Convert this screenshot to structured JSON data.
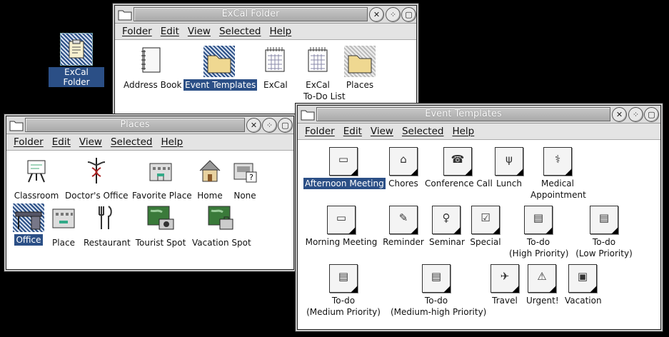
{
  "desktop": {
    "icon_label": "ExCal Folder"
  },
  "excal_window": {
    "title": "ExCal Folder",
    "menu": [
      "Folder",
      "Edit",
      "View",
      "Selected",
      "Help"
    ],
    "items": [
      {
        "label": "Address Book",
        "icon": "address-book-icon"
      },
      {
        "label": "Event Templates",
        "icon": "folder-icon",
        "selected": true
      },
      {
        "label": "ExCal",
        "icon": "calendar-icon"
      },
      {
        "label": "ExCal",
        "label2": "To-Do List",
        "icon": "todo-calendar-icon"
      },
      {
        "label": "Places",
        "icon": "folder-icon"
      }
    ]
  },
  "places_window": {
    "title": "Places",
    "menu": [
      "Folder",
      "Edit",
      "View",
      "Selected",
      "Help"
    ],
    "items": [
      {
        "label": "Classroom",
        "icon": "easel-icon"
      },
      {
        "label": "Doctor's Office",
        "icon": "caduceus-icon"
      },
      {
        "label": "Favorite Place",
        "icon": "building-icon"
      },
      {
        "label": "Home",
        "icon": "house-icon"
      },
      {
        "label": "None",
        "icon": "unknown-place-icon"
      },
      {
        "label": "Office",
        "icon": "desk-icon",
        "selected": true
      },
      {
        "label": "Place",
        "icon": "building-icon"
      },
      {
        "label": "Restaurant",
        "icon": "utensils-icon"
      },
      {
        "label": "Tourist Spot",
        "icon": "map-camera-icon"
      },
      {
        "label": "Vacation Spot",
        "icon": "map-suitcase-icon"
      }
    ]
  },
  "event_window": {
    "title": "Event Templates",
    "menu": [
      "Folder",
      "Edit",
      "View",
      "Selected",
      "Help"
    ],
    "items": [
      {
        "label": "Afternoon Meeting",
        "icon": "meeting-icon",
        "selected": true
      },
      {
        "label": "Chores",
        "icon": "house-icon"
      },
      {
        "label": "Conference Call",
        "icon": "telephone-icon"
      },
      {
        "label": "Lunch",
        "icon": "utensils-icon"
      },
      {
        "label": "Medical",
        "label2": "Appointment",
        "icon": "caduceus-icon"
      },
      {
        "label": "Morning Meeting",
        "icon": "meeting-icon"
      },
      {
        "label": "Reminder",
        "icon": "note-icon"
      },
      {
        "label": "Seminar",
        "icon": "podium-icon"
      },
      {
        "label": "Special",
        "icon": "checkbox-icon"
      },
      {
        "label": "To-do",
        "label2": "(High Priority)",
        "icon": "todo-icon"
      },
      {
        "label": "To-do",
        "label2": "(Low Priority)",
        "icon": "todo-icon"
      },
      {
        "label": "To-do",
        "label2": "(Medium Priority)",
        "icon": "todo-icon"
      },
      {
        "label": "To-do",
        "label2": "(Medium-high Priority)",
        "icon": "todo-icon"
      },
      {
        "label": "Travel",
        "icon": "airplane-icon"
      },
      {
        "label": "Urgent!",
        "icon": "warning-icon"
      },
      {
        "label": "Vacation",
        "icon": "suitcase-icon"
      }
    ]
  }
}
